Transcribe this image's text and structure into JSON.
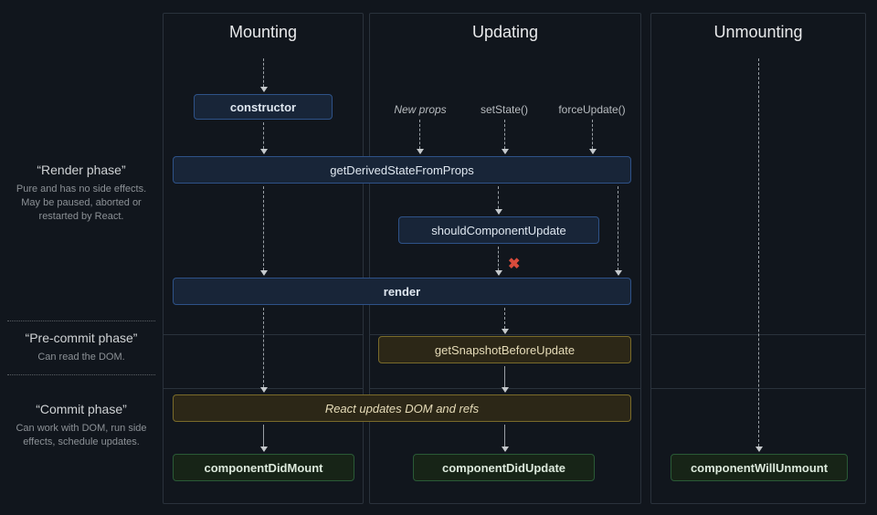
{
  "sidebar": {
    "render": {
      "title": "“Render phase”",
      "desc": "Pure and has no side effects. May be paused, aborted or restarted by React."
    },
    "precommit": {
      "title": "“Pre-commit phase”",
      "desc": "Can read the DOM."
    },
    "commit": {
      "title": "“Commit phase”",
      "desc": "Can work with DOM, run side effects, schedule updates."
    }
  },
  "columns": {
    "mount": "Mounting",
    "update": "Updating",
    "unmnt": "Unmounting"
  },
  "triggers": {
    "newprops": "New props",
    "setstate": "setState()",
    "forceupdate": "forceUpdate()"
  },
  "boxes": {
    "constructor": "constructor",
    "gdsfp": "getDerivedStateFromProps",
    "scu": "shouldComponentUpdate",
    "render": "render",
    "gsbu": "getSnapshotBeforeUpdate",
    "domrefs": "React updates DOM and refs",
    "cdm": "componentDidMount",
    "cdu": "componentDidUpdate",
    "cwu": "componentWillUnmount"
  },
  "x": "✖"
}
